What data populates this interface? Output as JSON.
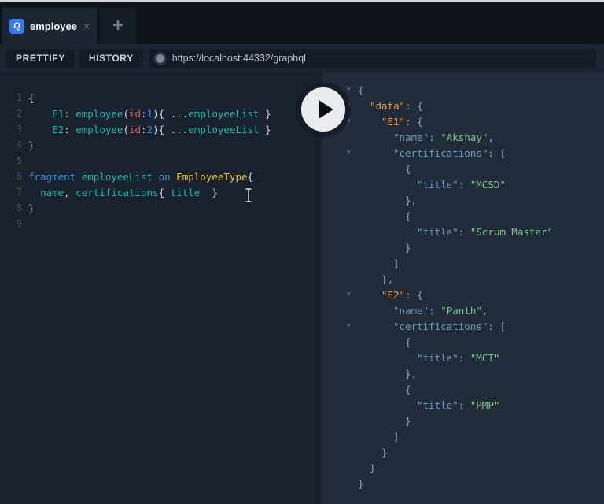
{
  "tab_bar": {
    "tabs": [
      {
        "icon": "Q",
        "label": "employee",
        "close_glyph": "×"
      }
    ],
    "new_tab_glyph": "+"
  },
  "toolbar": {
    "prettify_label": "PRETTIFY",
    "history_label": "HISTORY",
    "url": "https://localhost:44332/graphql"
  },
  "colors": {
    "tab_accent_blue": "#3a78e8",
    "editor_bg": "#1b222f",
    "response_bg": "#222b39",
    "toolbar_bg": "#1b2533",
    "teal_token": "#2fb1a9",
    "keyword_blue": "#4a8fce",
    "type_yellow": "#e2c64a",
    "arg_red": "#d75f56",
    "number_blue": "#4484d8",
    "key_orange": "#dda158",
    "key_steel_blue": "#6f9abc",
    "string_green": "#81c595"
  },
  "query_editor": {
    "lines": [
      {
        "num": "1",
        "tokens": [
          {
            "t": "{",
            "c": "p"
          }
        ]
      },
      {
        "num": "2",
        "tokens": [
          {
            "t": "    ",
            "c": "p"
          },
          {
            "t": "E1",
            "c": "teal"
          },
          {
            "t": ": ",
            "c": "p"
          },
          {
            "t": "employee",
            "c": "teal"
          },
          {
            "t": "(",
            "c": "p"
          },
          {
            "t": "id",
            "c": "red"
          },
          {
            "t": ":",
            "c": "p"
          },
          {
            "t": "1",
            "c": "num"
          },
          {
            "t": "){ ",
            "c": "p"
          },
          {
            "t": "...",
            "c": "p"
          },
          {
            "t": "employeeList",
            "c": "teal"
          },
          {
            "t": " }",
            "c": "p"
          }
        ]
      },
      {
        "num": "3",
        "tokens": [
          {
            "t": "    ",
            "c": "p"
          },
          {
            "t": "E2",
            "c": "teal"
          },
          {
            "t": ": ",
            "c": "p"
          },
          {
            "t": "employee",
            "c": "teal"
          },
          {
            "t": "(",
            "c": "p"
          },
          {
            "t": "id",
            "c": "red"
          },
          {
            "t": ":",
            "c": "p"
          },
          {
            "t": "2",
            "c": "num"
          },
          {
            "t": "){ ",
            "c": "p"
          },
          {
            "t": "...",
            "c": "p"
          },
          {
            "t": "employeeList",
            "c": "teal"
          },
          {
            "t": " }",
            "c": "p"
          }
        ]
      },
      {
        "num": "4",
        "tokens": [
          {
            "t": "}",
            "c": "p"
          }
        ]
      },
      {
        "num": "5",
        "tokens": []
      },
      {
        "num": "6",
        "tokens": [
          {
            "t": "fragment",
            "c": "kw"
          },
          {
            "t": " ",
            "c": "p"
          },
          {
            "t": "employeeList",
            "c": "teal"
          },
          {
            "t": " ",
            "c": "p"
          },
          {
            "t": "on",
            "c": "kw"
          },
          {
            "t": " ",
            "c": "p"
          },
          {
            "t": "EmployeeType",
            "c": "type"
          },
          {
            "t": "{",
            "c": "p"
          }
        ]
      },
      {
        "num": "7",
        "tokens": [
          {
            "t": "  ",
            "c": "p"
          },
          {
            "t": "name",
            "c": "teal"
          },
          {
            "t": ", ",
            "c": "p"
          },
          {
            "t": "certifications",
            "c": "teal"
          },
          {
            "t": "{ ",
            "c": "p"
          },
          {
            "t": "title",
            "c": "teal"
          },
          {
            "t": "  }",
            "c": "p"
          }
        ]
      },
      {
        "num": "8",
        "tokens": [
          {
            "t": "}",
            "c": "p"
          }
        ]
      },
      {
        "num": "9",
        "tokens": []
      }
    ]
  },
  "response": {
    "lines": [
      {
        "indent": 0,
        "fold": true,
        "tokens": [
          {
            "t": "{",
            "c": "rp"
          }
        ]
      },
      {
        "indent": 1,
        "fold": true,
        "tokens": [
          {
            "t": "\"data\"",
            "c": "ko"
          },
          {
            "t": ": {",
            "c": "rp"
          }
        ]
      },
      {
        "indent": 2,
        "fold": true,
        "tokens": [
          {
            "t": "\"E1\"",
            "c": "ko"
          },
          {
            "t": ": {",
            "c": "rp"
          }
        ]
      },
      {
        "indent": 3,
        "fold": false,
        "tokens": [
          {
            "t": "\"name\"",
            "c": "kb"
          },
          {
            "t": ": ",
            "c": "rp"
          },
          {
            "t": "\"Akshay\"",
            "c": "s"
          },
          {
            "t": ",",
            "c": "rp"
          }
        ]
      },
      {
        "indent": 3,
        "fold": true,
        "tokens": [
          {
            "t": "\"certifications\"",
            "c": "kb"
          },
          {
            "t": ": [",
            "c": "rp"
          }
        ]
      },
      {
        "indent": 4,
        "fold": false,
        "tokens": [
          {
            "t": "{",
            "c": "rp"
          }
        ]
      },
      {
        "indent": 5,
        "fold": false,
        "tokens": [
          {
            "t": "\"title\"",
            "c": "kb"
          },
          {
            "t": ": ",
            "c": "rp"
          },
          {
            "t": "\"MCSD\"",
            "c": "s"
          }
        ]
      },
      {
        "indent": 4,
        "fold": false,
        "tokens": [
          {
            "t": "},",
            "c": "rp"
          }
        ]
      },
      {
        "indent": 4,
        "fold": false,
        "tokens": [
          {
            "t": "{",
            "c": "rp"
          }
        ]
      },
      {
        "indent": 5,
        "fold": false,
        "tokens": [
          {
            "t": "\"title\"",
            "c": "kb"
          },
          {
            "t": ": ",
            "c": "rp"
          },
          {
            "t": "\"Scrum Master\"",
            "c": "s"
          }
        ]
      },
      {
        "indent": 4,
        "fold": false,
        "tokens": [
          {
            "t": "}",
            "c": "rp"
          }
        ]
      },
      {
        "indent": 3,
        "fold": false,
        "tokens": [
          {
            "t": "]",
            "c": "rp"
          }
        ]
      },
      {
        "indent": 2,
        "fold": false,
        "tokens": [
          {
            "t": "},",
            "c": "rp"
          }
        ]
      },
      {
        "indent": 2,
        "fold": true,
        "tokens": [
          {
            "t": "\"E2\"",
            "c": "ko"
          },
          {
            "t": ": {",
            "c": "rp"
          }
        ]
      },
      {
        "indent": 3,
        "fold": false,
        "tokens": [
          {
            "t": "\"name\"",
            "c": "kb"
          },
          {
            "t": ": ",
            "c": "rp"
          },
          {
            "t": "\"Panth\"",
            "c": "s"
          },
          {
            "t": ",",
            "c": "rp"
          }
        ]
      },
      {
        "indent": 3,
        "fold": true,
        "tokens": [
          {
            "t": "\"certifications\"",
            "c": "kb"
          },
          {
            "t": ": [",
            "c": "rp"
          }
        ]
      },
      {
        "indent": 4,
        "fold": false,
        "tokens": [
          {
            "t": "{",
            "c": "rp"
          }
        ]
      },
      {
        "indent": 5,
        "fold": false,
        "tokens": [
          {
            "t": "\"title\"",
            "c": "kb"
          },
          {
            "t": ": ",
            "c": "rp"
          },
          {
            "t": "\"MCT\"",
            "c": "s"
          }
        ]
      },
      {
        "indent": 4,
        "fold": false,
        "tokens": [
          {
            "t": "},",
            "c": "rp"
          }
        ]
      },
      {
        "indent": 4,
        "fold": false,
        "tokens": [
          {
            "t": "{",
            "c": "rp"
          }
        ]
      },
      {
        "indent": 5,
        "fold": false,
        "tokens": [
          {
            "t": "\"title\"",
            "c": "kb"
          },
          {
            "t": ": ",
            "c": "rp"
          },
          {
            "t": "\"PMP\"",
            "c": "s"
          }
        ]
      },
      {
        "indent": 4,
        "fold": false,
        "tokens": [
          {
            "t": "}",
            "c": "rp"
          }
        ]
      },
      {
        "indent": 3,
        "fold": false,
        "tokens": [
          {
            "t": "]",
            "c": "rp"
          }
        ]
      },
      {
        "indent": 2,
        "fold": false,
        "tokens": [
          {
            "t": "}",
            "c": "rp"
          }
        ]
      },
      {
        "indent": 1,
        "fold": false,
        "tokens": [
          {
            "t": "}",
            "c": "rp"
          }
        ]
      },
      {
        "indent": 0,
        "fold": false,
        "tokens": [
          {
            "t": "}",
            "c": "rp"
          }
        ]
      }
    ]
  }
}
